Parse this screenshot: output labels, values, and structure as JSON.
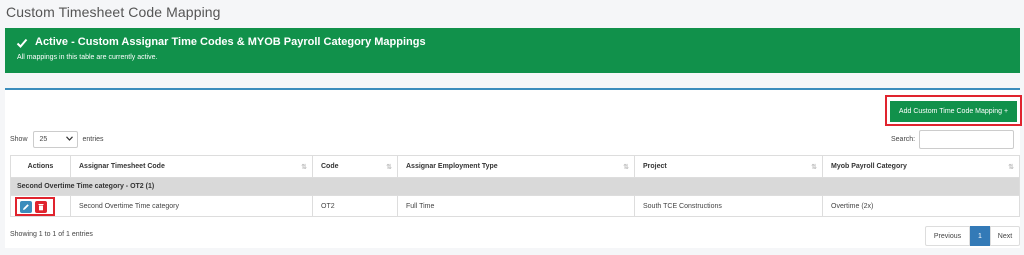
{
  "page": {
    "title": "Custom Timesheet Code Mapping"
  },
  "alert": {
    "title": "Active - Custom Assignar Time Codes & MYOB Payroll Category Mappings",
    "subtitle": "All mappings in this table are currently active.",
    "icon": "check-icon",
    "color": "#11914b"
  },
  "toolbar": {
    "add_label": "Add Custom Time Code Mapping +"
  },
  "length": {
    "show_label": "Show",
    "value": "25",
    "entries_label": "entries"
  },
  "search": {
    "label": "Search:",
    "value": ""
  },
  "table": {
    "headers": [
      "Actions",
      "Assignar Timesheet Code",
      "Code",
      "Assignar Employment Type",
      "Project",
      "Myob Payroll Category"
    ],
    "group_label": "Second Overtime Time category - OT2 (1)",
    "row": {
      "timesheet_code": "Second Overtime Time category",
      "code": "OT2",
      "employment_type": "Full Time",
      "project": "South TCE Constructions",
      "payroll_category": "Overtime (2x)"
    }
  },
  "footer": {
    "info": "Showing 1 to 1 of 1 entries",
    "prev": "Previous",
    "page": "1",
    "next": "Next"
  },
  "colors": {
    "accent": "#3c8dbc",
    "success": "#11914b",
    "danger": "#e0242e"
  }
}
